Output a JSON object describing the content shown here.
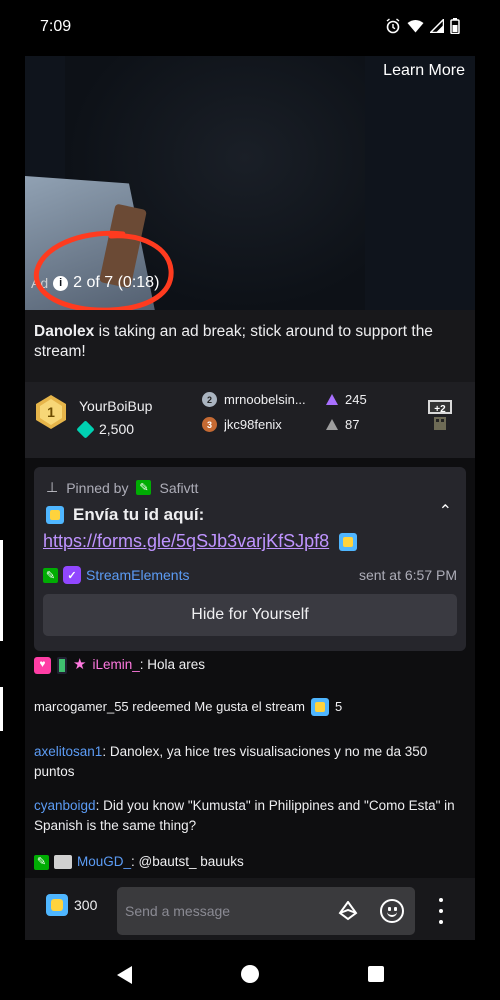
{
  "status_bar": {
    "time": "7:09"
  },
  "video": {
    "learn_more": "Learn More",
    "ad_prefix": "Ad",
    "ad_counter": "2 of 7 (0:18)"
  },
  "ad_message": {
    "streamer": "Danolex",
    "text": " is taking an ad break; stick around to support the stream!"
  },
  "leaderboard": {
    "first": {
      "rank": "1",
      "name": "YourBoiBup",
      "value": "2,500"
    },
    "second": {
      "rank": "2",
      "name": "mrnoobelsin...",
      "value": "245"
    },
    "third": {
      "rank": "3",
      "name": "jkc98fenix",
      "value": "87"
    },
    "extra_label": "+2"
  },
  "pinned": {
    "prefix": "Pinned by",
    "pinned_by": "Safivtt",
    "title": "Envía tu id aquí:",
    "link": "https://forms.gle/5qSJb3varjKfSJpf8",
    "author": "StreamElements",
    "time": "sent at 6:57 PM",
    "hide_label": "Hide for Yourself"
  },
  "chat": {
    "messages": [
      {
        "user": "iLemin_",
        "text": ": Hola ares",
        "user_color": "#ff79e0"
      },
      {
        "text": "marcogamer_55 redeemed Me gusta el stream",
        "cost": "5"
      },
      {
        "user": "axelitosan1",
        "text": ": Danolex, ya hice tres visualisaciones y no me da 350 puntos",
        "user_color": "#5c9cf5"
      },
      {
        "user": "cyanboigd",
        "text": ": Did you know \"Kumusta\" in Philippines and \"Como Esta\" in Spanish is the same thing?",
        "user_color": "#5c9cf5"
      },
      {
        "user": "MouGD_",
        "text": ": @bautst_ bauuks",
        "user_color": "#5c9cf5"
      }
    ]
  },
  "input_bar": {
    "points": "300",
    "placeholder": "Send a message"
  },
  "colors": {
    "accent": "#9147ff",
    "link": "#bf94ff",
    "annotation": "#ff3b1f"
  }
}
